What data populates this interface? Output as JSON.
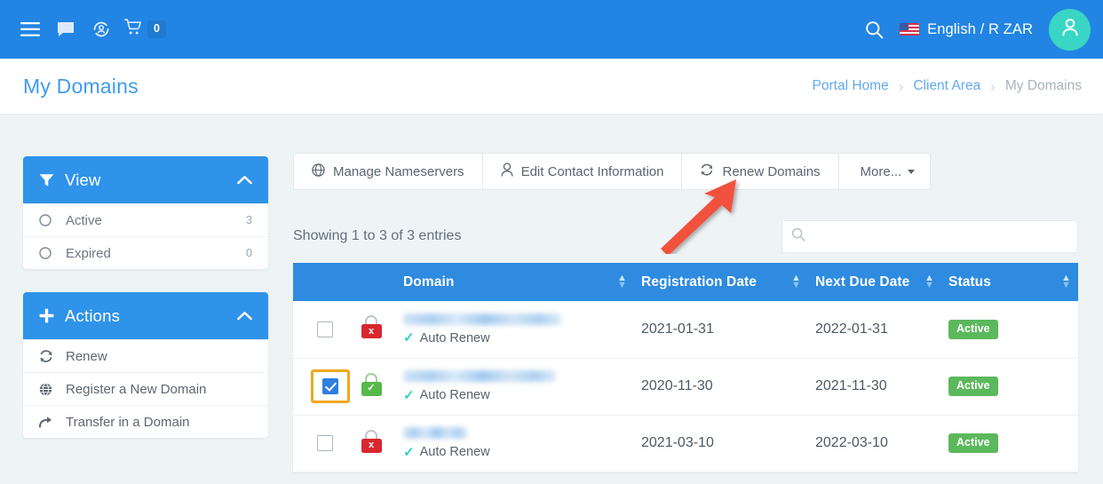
{
  "topnav": {
    "menu_icon": "hamburger-menu-icon",
    "chat_icon": "chat-bubble-icon",
    "support_icon": "support-agent-icon",
    "cart_icon": "shopping-cart-icon",
    "cart_count": "0",
    "search_icon": "search-icon",
    "flag_icon": "us-flag-icon",
    "language_currency": "English / R ZAR",
    "avatar_icon": "user-avatar-icon",
    "bg_color": "#2285e3",
    "avatar_color": "#3ad6c5"
  },
  "titlebar": {
    "page_title": "My Domains",
    "breadcrumb": [
      {
        "label": "Portal Home",
        "current": false
      },
      {
        "label": "Client Area",
        "current": false
      },
      {
        "label": "My Domains",
        "current": true
      }
    ]
  },
  "sidebar": {
    "view_panel": {
      "icon": "filter-funnel-icon",
      "title": "View",
      "chevron": "chevron-up-icon",
      "items": [
        {
          "icon": "radio-circle-icon",
          "label": "Active",
          "count": "3"
        },
        {
          "icon": "radio-circle-icon",
          "label": "Expired",
          "count": "0"
        }
      ]
    },
    "actions_panel": {
      "icon": "plus-icon",
      "title": "Actions",
      "chevron": "chevron-up-icon",
      "items": [
        {
          "icon": "renew-refresh-icon",
          "label": "Renew"
        },
        {
          "icon": "globe-icon",
          "label": "Register a New Domain"
        },
        {
          "icon": "transfer-arrow-icon",
          "label": "Transfer in a Domain"
        }
      ]
    }
  },
  "toolbar": {
    "buttons": [
      {
        "icon": "globe-icon",
        "label": "Manage Nameservers"
      },
      {
        "icon": "user-outline-icon",
        "label": "Edit Contact Information"
      },
      {
        "icon": "renew-refresh-icon",
        "label": "Renew Domains"
      },
      {
        "icon": "caret-down-icon",
        "label": "More..."
      }
    ]
  },
  "table_meta": {
    "showing_text": "Showing 1 to 3 of 3 entries",
    "search_icon": "search-icon",
    "search_value": "",
    "search_placeholder": ""
  },
  "table": {
    "headers": [
      {
        "label": "",
        "sortable": false
      },
      {
        "label": "",
        "sortable": false
      },
      {
        "label": "Domain",
        "sortable": true
      },
      {
        "label": "Registration Date",
        "sortable": true
      },
      {
        "label": "Next Due Date",
        "sortable": true
      },
      {
        "label": "Status",
        "sortable": true
      }
    ],
    "rows": [
      {
        "checked": false,
        "highlighted": false,
        "lock": {
          "icon": "lock-icon",
          "state": "red",
          "glyph": "x"
        },
        "domain": "",
        "domain_redacted": true,
        "auto_renew_label": "Auto Renew",
        "registration_date": "2021-01-31",
        "next_due_date": "2022-01-31",
        "status": "Active"
      },
      {
        "checked": true,
        "highlighted": true,
        "lock": {
          "icon": "lock-icon",
          "state": "green",
          "glyph": "✓"
        },
        "domain": "",
        "domain_redacted": true,
        "auto_renew_label": "Auto Renew",
        "registration_date": "2020-11-30",
        "next_due_date": "2021-11-30",
        "status": "Active"
      },
      {
        "checked": false,
        "highlighted": false,
        "lock": {
          "icon": "lock-icon",
          "state": "red",
          "glyph": "x"
        },
        "domain": "",
        "domain_redacted": true,
        "auto_renew_label": "Auto Renew",
        "registration_date": "2021-03-10",
        "next_due_date": "2022-03-10",
        "status": "Active"
      }
    ]
  },
  "annotation": {
    "arrow_icon": "red-arrow-pointer-icon",
    "arrow_color": "#f2513c",
    "points_to": "Renew Domains",
    "highlight_color": "#f0a81e",
    "highlight_target": "row-2-checkbox"
  }
}
